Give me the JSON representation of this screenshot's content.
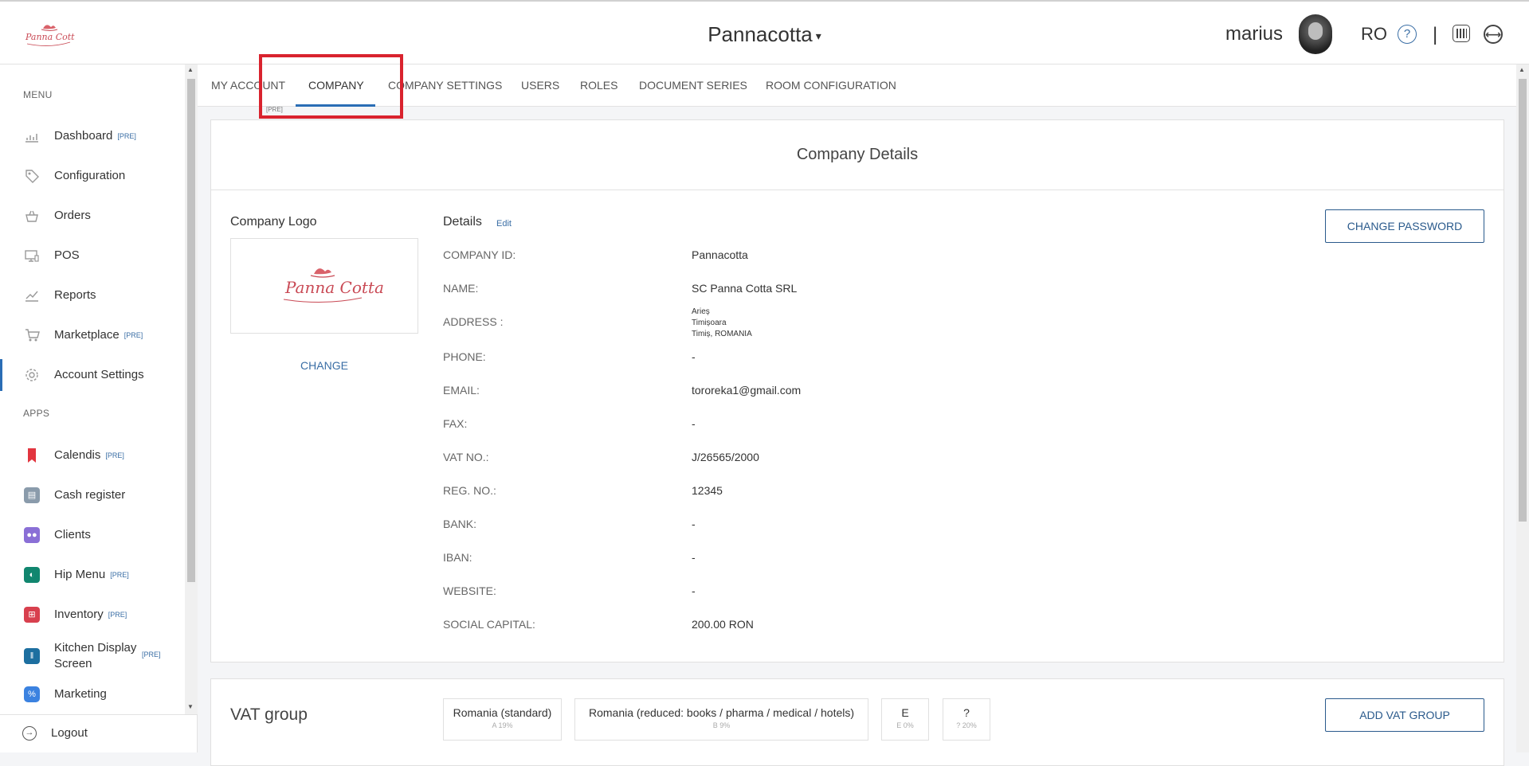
{
  "header": {
    "logo_text": "Panna Cotta",
    "brand": "Pannacotta",
    "brand_caret": "▾",
    "user_name": "marius",
    "language": "RO",
    "help_glyph": "?",
    "separator": "|",
    "icons": [
      "panna-cotta-logo",
      "help-icon",
      "barcode-icon",
      "swap-icon",
      "avatar"
    ]
  },
  "sidebar": {
    "menu_section": "MENU",
    "menu_items": [
      {
        "label": "Dashboard",
        "badge": "[PRE]",
        "icon": "chart-icon"
      },
      {
        "label": "Configuration",
        "badge": "",
        "icon": "tag-icon"
      },
      {
        "label": "Orders",
        "badge": "",
        "icon": "basket-icon"
      },
      {
        "label": "POS",
        "badge": "",
        "icon": "monitor-icon"
      },
      {
        "label": "Reports",
        "badge": "",
        "icon": "report-chart-icon"
      },
      {
        "label": "Marketplace",
        "badge": "[PRE]",
        "icon": "cart-icon"
      },
      {
        "label": "Account Settings",
        "badge": "",
        "icon": "gear-icon"
      }
    ],
    "apps_section": "APPS",
    "app_items": [
      {
        "label": "Calendis",
        "badge": "[PRE]",
        "icon": "bookmark-icon",
        "color": "#e2353f"
      },
      {
        "label": "Cash register",
        "badge": "",
        "icon": "cash-register-icon",
        "color": "#8a9bab"
      },
      {
        "label": "Clients",
        "badge": "",
        "icon": "clients-icon",
        "color": "#8a6fd6"
      },
      {
        "label": "Hip Menu",
        "badge": "[PRE]",
        "icon": "compass-icon",
        "color": "#11866f"
      },
      {
        "label": "Inventory",
        "badge": "[PRE]",
        "icon": "inventory-icon",
        "color": "#d8404e"
      },
      {
        "label": "Kitchen Display",
        "label2": "Screen",
        "badge": "[PRE]",
        "icon": "cutlery-icon",
        "color": "#1d6fa0"
      },
      {
        "label": "Marketing",
        "badge": "",
        "icon": "marketing-icon",
        "color": "#3b82e0"
      }
    ],
    "logout": "Logout"
  },
  "tabs": {
    "items": [
      "MY ACCOUNT",
      "COMPANY",
      "COMPANY SETTINGS",
      "USERS",
      "ROLES",
      "DOCUMENT SERIES",
      "ROOM CONFIGURATION"
    ],
    "active": "COMPANY",
    "active_badge": "[PRE]"
  },
  "company": {
    "title": "Company Details",
    "logo_title": "Company Logo",
    "logo_text": "Panna Cotta",
    "change_label": "CHANGE",
    "details_title": "Details",
    "edit_label": "Edit",
    "change_password_label": "CHANGE PASSWORD",
    "rows": [
      {
        "label": "COMPANY ID:",
        "value": "Pannacotta"
      },
      {
        "label": "NAME:",
        "value": "SC Panna Cotta SRL"
      },
      {
        "label": "ADDRESS :",
        "value": ""
      },
      {
        "label": "PHONE:",
        "value": "-"
      },
      {
        "label": "EMAIL:",
        "value": "tororeka1@gmail.com"
      },
      {
        "label": "FAX:",
        "value": "-"
      },
      {
        "label": "VAT NO.:",
        "value": "J/26565/2000"
      },
      {
        "label": "REG. NO.:",
        "value": "12345"
      },
      {
        "label": "BANK:",
        "value": "-"
      },
      {
        "label": "IBAN:",
        "value": "-"
      },
      {
        "label": "WEBSITE:",
        "value": "-"
      },
      {
        "label": "SOCIAL CAPITAL:",
        "value": "200.00 RON"
      }
    ],
    "address_lines": [
      "Arieș",
      "Timișoara",
      "Timiș, ROMANIA"
    ]
  },
  "vat": {
    "title": "VAT group",
    "add_label": "ADD VAT GROUP",
    "groups": [
      {
        "name": "Romania (standard)",
        "rate": "A 19%"
      },
      {
        "name": "Romania (reduced: books / pharma / medical / hotels)",
        "rate": "B 9%"
      },
      {
        "name": "E",
        "rate": "E 0%"
      },
      {
        "name": "?",
        "rate": "? 20%"
      }
    ]
  },
  "colors": {
    "accent": "#2a6db5",
    "highlight": "#d9232e",
    "link": "#3a6ea5"
  }
}
